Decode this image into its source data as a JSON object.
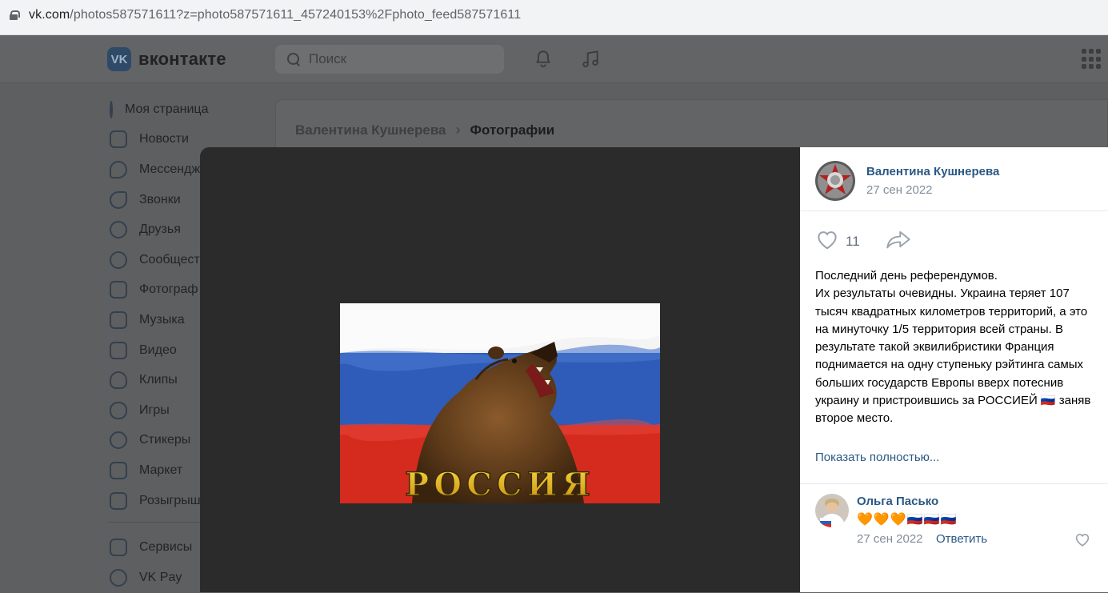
{
  "browser": {
    "url_host": "vk.com",
    "url_path": "/photos587571611?z=photo587571611_457240153%2Fphoto_feed587571611"
  },
  "header": {
    "logo_text": "вконтакте",
    "search_placeholder": "Поиск"
  },
  "sidebar": {
    "items": [
      {
        "label": "Моя страница",
        "icon": "profile-icon"
      },
      {
        "label": "Новости",
        "icon": "news-icon"
      },
      {
        "label": "Мессендж",
        "icon": "messenger-icon"
      },
      {
        "label": "Звонки",
        "icon": "phone-icon"
      },
      {
        "label": "Друзья",
        "icon": "friends-icon"
      },
      {
        "label": "Сообщест",
        "icon": "communities-icon"
      },
      {
        "label": "Фотограф",
        "icon": "photos-icon"
      },
      {
        "label": "Музыка",
        "icon": "music-icon"
      },
      {
        "label": "Видео",
        "icon": "video-icon"
      },
      {
        "label": "Клипы",
        "icon": "clips-icon"
      },
      {
        "label": "Игры",
        "icon": "games-icon"
      },
      {
        "label": "Стикеры",
        "icon": "stickers-icon"
      },
      {
        "label": "Маркет",
        "icon": "market-icon"
      },
      {
        "label": "Розыгрыш",
        "icon": "giveaways-icon"
      }
    ],
    "extra_items": [
      {
        "label": "Сервисы",
        "icon": "services-icon"
      },
      {
        "label": "VK Pay",
        "icon": "vkpay-icon"
      }
    ]
  },
  "breadcrumb": {
    "owner": "Валентина Кушнерева",
    "current": "Фотографии"
  },
  "photo": {
    "caption_in_image": "РОССИЯ"
  },
  "panel": {
    "author_name": "Валентина Кушнерева",
    "author_date": "27 сен 2022",
    "likes": "11",
    "post_text": "Последний день референдумов.\nИх результаты очевидны. Украина теряет 107 тысяч квадратных километров территорий, а это на минуточку 1/5 территория всей страны. В результате такой эквилибристики Франция поднимается на одну ступеньку рэйтинга самых больших государств Европы вверх потеснив украину и пристроившись за РОССИЕЙ 🇷🇺 заняв второе место.",
    "show_more": "Показать полностью...",
    "comment": {
      "author": "Ольга Пасько",
      "text": "🧡🧡🧡🇷🇺🇷🇺🇷🇺",
      "date": "27 сен 2022",
      "reply": "Ответить"
    }
  },
  "colors": {
    "link": "#2a5885",
    "muted": "#818c99",
    "viewer_bg": "#2b2b2b"
  }
}
